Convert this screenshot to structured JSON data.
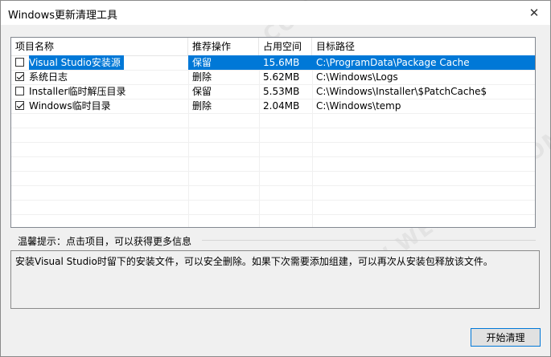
{
  "window": {
    "title": "Windows更新清理工具",
    "close_glyph": "✕"
  },
  "table": {
    "columns": [
      "项目名称",
      "推荐操作",
      "占用空间",
      "目标路径"
    ],
    "rows": [
      {
        "checked": false,
        "selected": true,
        "name": "Visual Studio安装源",
        "action": "保留",
        "size": "15.6MB",
        "path": "C:\\ProgramData\\Package Cache"
      },
      {
        "checked": true,
        "selected": false,
        "name": "系统日志",
        "action": "删除",
        "size": "5.62MB",
        "path": "C:\\Windows\\Logs"
      },
      {
        "checked": false,
        "selected": false,
        "name": "Installer临时解压目录",
        "action": "保留",
        "size": "5.53MB",
        "path": "C:\\Windows\\Installer\\$PatchCache$"
      },
      {
        "checked": true,
        "selected": false,
        "name": "Windows临时目录",
        "action": "删除",
        "size": "2.04MB",
        "path": "C:\\Windows\\temp"
      }
    ]
  },
  "tip": {
    "label": "温馨提示：点击项目，可以获得更多信息"
  },
  "description": {
    "text": "安装Visual Studio时留下的安装文件，可以安全删除。如果下次需要添加组建，可以再次从安装包释放该文件。"
  },
  "buttons": {
    "start_label": "开始清理"
  },
  "colors": {
    "selection": "#0078d7",
    "button_border": "#0078d7"
  }
}
